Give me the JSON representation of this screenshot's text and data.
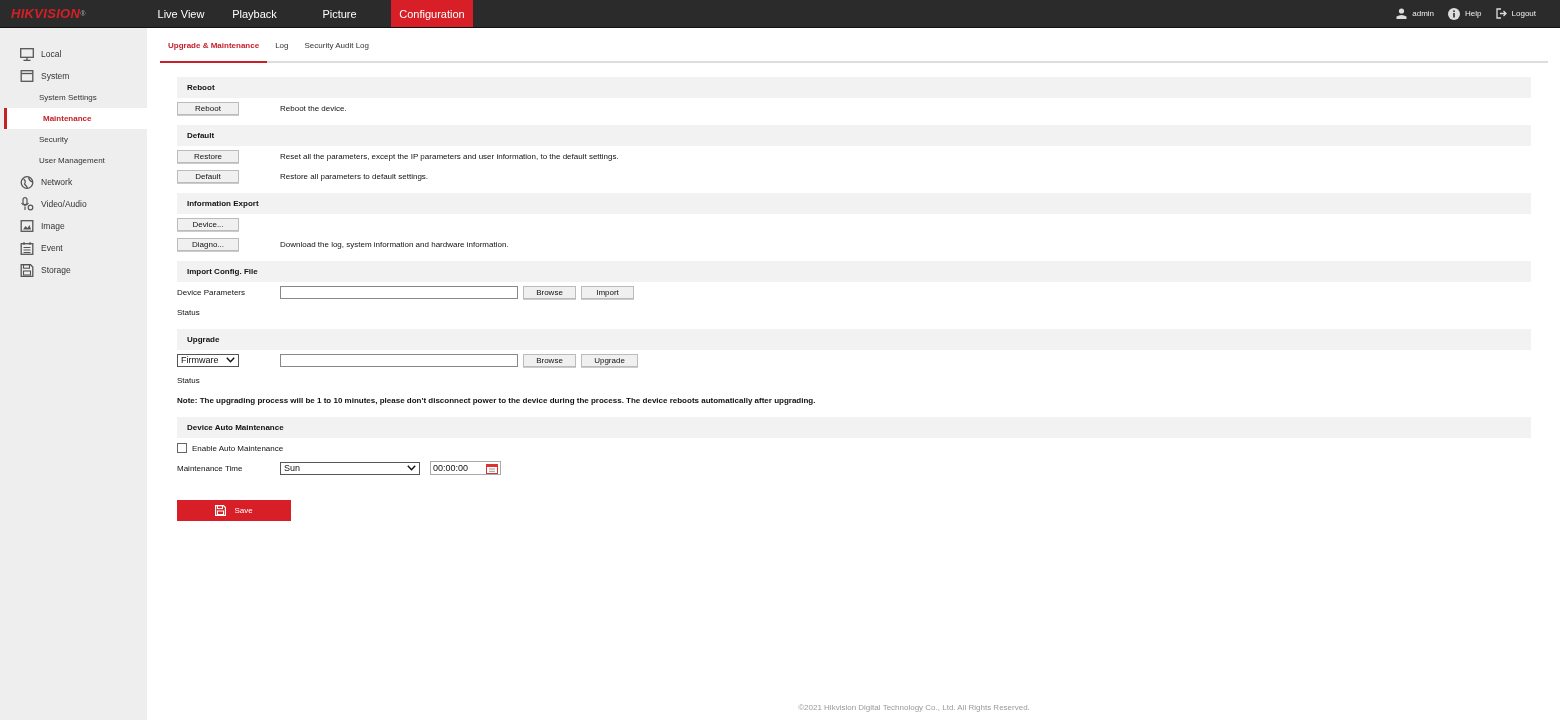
{
  "logo": "HIKVISION$^{®}$",
  "nav": [
    {
      "label": "Live View",
      "selected": false
    },
    {
      "label": "Playback",
      "selected": false
    },
    {
      "label": "Picture",
      "selected": false
    },
    {
      "label": "Configuration",
      "selected": true
    }
  ],
  "user": {
    "name": "admin"
  },
  "help": "Help",
  "logout": "Logout",
  "sidebar": [
    {
      "label": "Local",
      "kind": "monitor",
      "selected": false
    },
    {
      "label": "System",
      "kind": "window",
      "selected": false,
      "children": [
        {
          "label": "System Settings",
          "selected": false
        },
        {
          "label": "Maintenance",
          "selected": true
        },
        {
          "label": "Security",
          "selected": false
        },
        {
          "label": "User Management",
          "selected": false
        }
      ]
    },
    {
      "label": "Network",
      "kind": "globe",
      "selected": false
    },
    {
      "label": "Video/Audio",
      "kind": "mic",
      "selected": false
    },
    {
      "label": "Image",
      "kind": "image",
      "selected": false
    },
    {
      "label": "Event",
      "kind": "calendar",
      "selected": false
    },
    {
      "label": "Storage",
      "kind": "disk",
      "selected": false
    }
  ],
  "tabs": [
    {
      "label": "Upgrade & Maintenance",
      "selected": true
    },
    {
      "label": "Log",
      "selected": false
    },
    {
      "label": "Security Audit Log",
      "selected": false
    }
  ],
  "sections": [
    {
      "title": "Reboot",
      "rows": [
        {
          "kind": "button",
          "button": "Reboot",
          "description": "Reboot the device."
        }
      ]
    },
    {
      "title": "Default",
      "rows": [
        {
          "kind": "button",
          "button": "Restore",
          "description": "Reset all the parameters, except the IP parameters and user information, to the default settings."
        },
        {
          "kind": "button",
          "button": "Default",
          "description": "Restore all parameters to default settings."
        }
      ]
    },
    {
      "title": "Information Export",
      "rows": [
        {
          "kind": "button",
          "button": "Device..."
        },
        {
          "kind": "button",
          "button": "Diagno...",
          "description": "Download the log, system information and hardware information."
        }
      ]
    },
    {
      "title": "Import Config. File",
      "rows": [
        {
          "kind": "file",
          "label": "Device Parameters",
          "browse": "Browse",
          "action": "Import"
        },
        {
          "kind": "status",
          "label": "Status"
        }
      ]
    },
    {
      "title": "Upgrade",
      "rows": [
        {
          "kind": "select-file",
          "select": "Firmware",
          "browse": "Browse",
          "action": "Upgrade"
        },
        {
          "kind": "status",
          "label": "Status"
        },
        {
          "kind": "note",
          "text": "Note: The upgrading process will be 1 to 10 minutes, please don't disconnect power to the device during the process. The device reboots automatically after upgrading."
        }
      ]
    },
    {
      "title": "Device Auto Maintenance",
      "rows": [
        {
          "kind": "checkbox",
          "label": "Enable Auto Maintenance",
          "checked": false
        },
        {
          "kind": "time",
          "label": "Maintenance Time",
          "day": "Sun",
          "time": "00:00:00"
        }
      ]
    }
  ],
  "save": "Save",
  "footer": "©2021 Hikvision Digital Technology Co., Ltd. All Rights Reserved."
}
